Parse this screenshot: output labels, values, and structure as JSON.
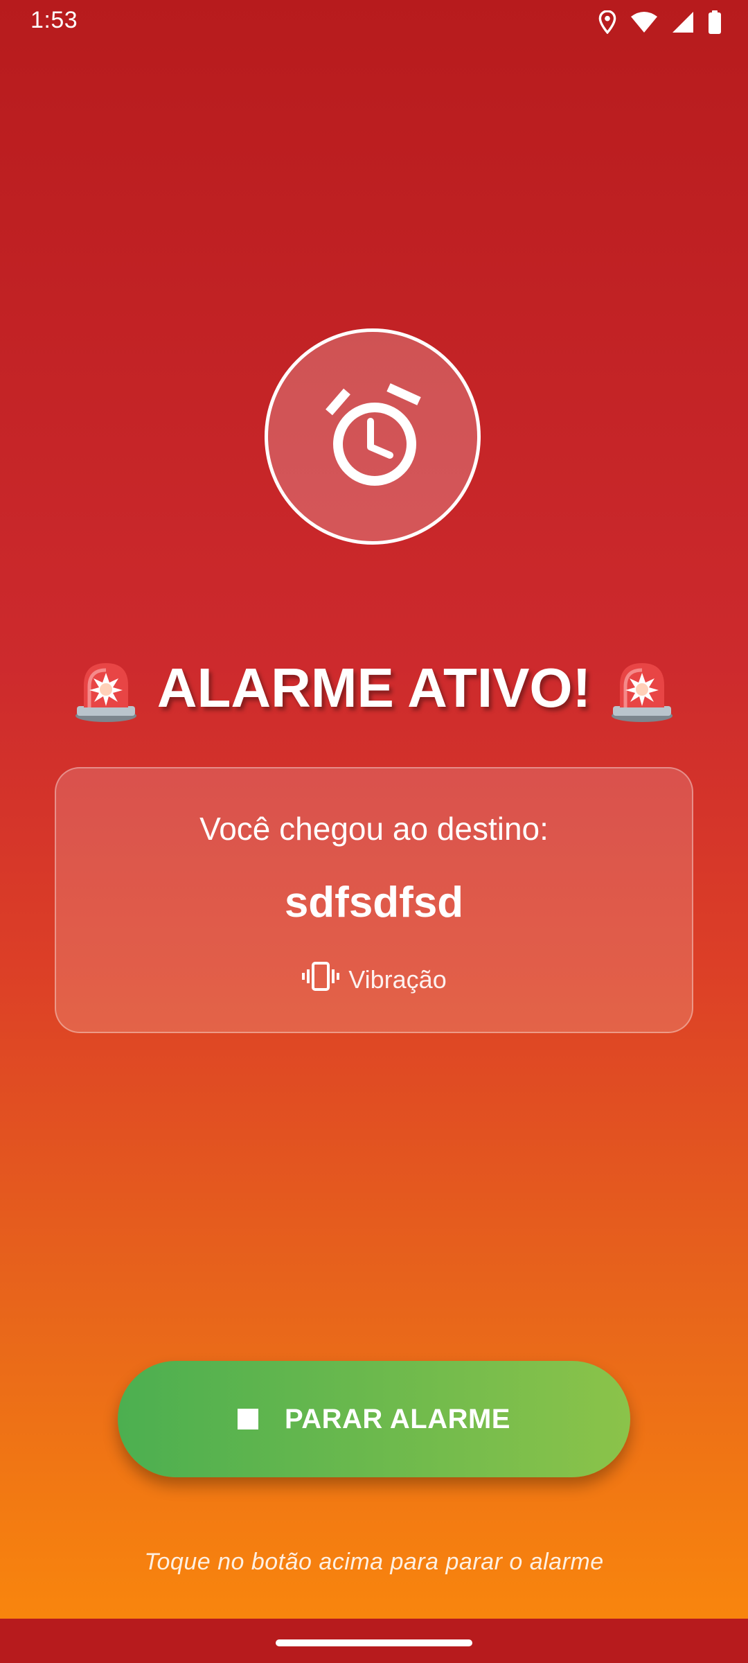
{
  "status_bar": {
    "time": "1:53",
    "icons": [
      "location-icon",
      "wifi-icon",
      "signal-icon",
      "battery-icon"
    ]
  },
  "alarm": {
    "icon": "alarm-clock-icon",
    "title": "ALARME ATIVO!",
    "title_icon": "police-siren-icon"
  },
  "card": {
    "label": "Você chegou ao destino:",
    "destination": "sdfsdfsd",
    "mode_icon": "vibration-icon",
    "mode_label": "Vibração"
  },
  "actions": {
    "stop_icon": "stop-square-icon",
    "stop_label": "PARAR ALARME",
    "hint": "Toque no botão acima para parar o alarme"
  },
  "colors": {
    "background_top": "#b71b1d",
    "background_bottom": "#fb8a0b",
    "button_start": "#4caf50",
    "button_end": "#8bc34a"
  }
}
